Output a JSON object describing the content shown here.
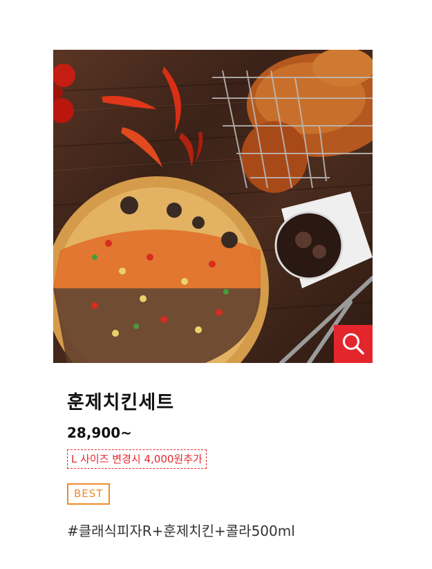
{
  "product": {
    "name": "훈제치킨세트",
    "price": "28,900~",
    "size_note": "L 사이즈 변경시 4,000원추가",
    "badge": "BEST",
    "description": "#클래식피자R+훈제치킨+콜라500ml"
  },
  "zoom_button": {
    "icon": "magnifier-icon"
  },
  "colors": {
    "accent_red": "#e4262c",
    "badge_orange": "#f08a2a",
    "text_dark": "#111111"
  }
}
